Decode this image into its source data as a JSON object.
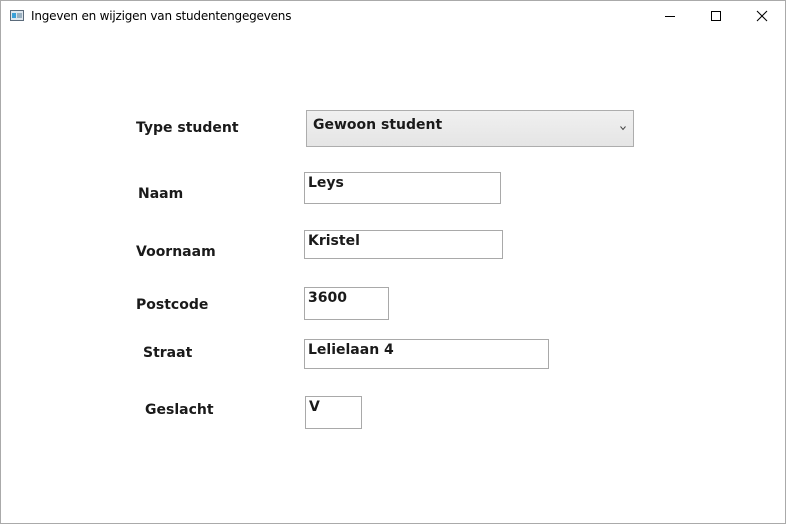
{
  "window": {
    "title": "Ingeven en wijzigen van studentengegevens"
  },
  "icons": {
    "app": "app-window-icon",
    "minimize": "minimize-icon",
    "maximize": "maximize-icon",
    "close": "close-icon",
    "dropdown": "chevron-down-icon"
  },
  "form": {
    "type_student": {
      "label": "Type student",
      "selected": "Gewoon student"
    },
    "naam": {
      "label": "Naam",
      "value": "Leys"
    },
    "voornaam": {
      "label": "Voornaam",
      "value": "Kristel"
    },
    "postcode": {
      "label": "Postcode",
      "value": "3600"
    },
    "straat": {
      "label": "Straat",
      "value": "Lelielaan 4"
    },
    "geslacht": {
      "label": "Geslacht",
      "value": "V"
    }
  },
  "colors": {
    "field_border": "#a9a9a9",
    "combo_background": "#e8e8e8",
    "text": "#1a1a1a"
  }
}
